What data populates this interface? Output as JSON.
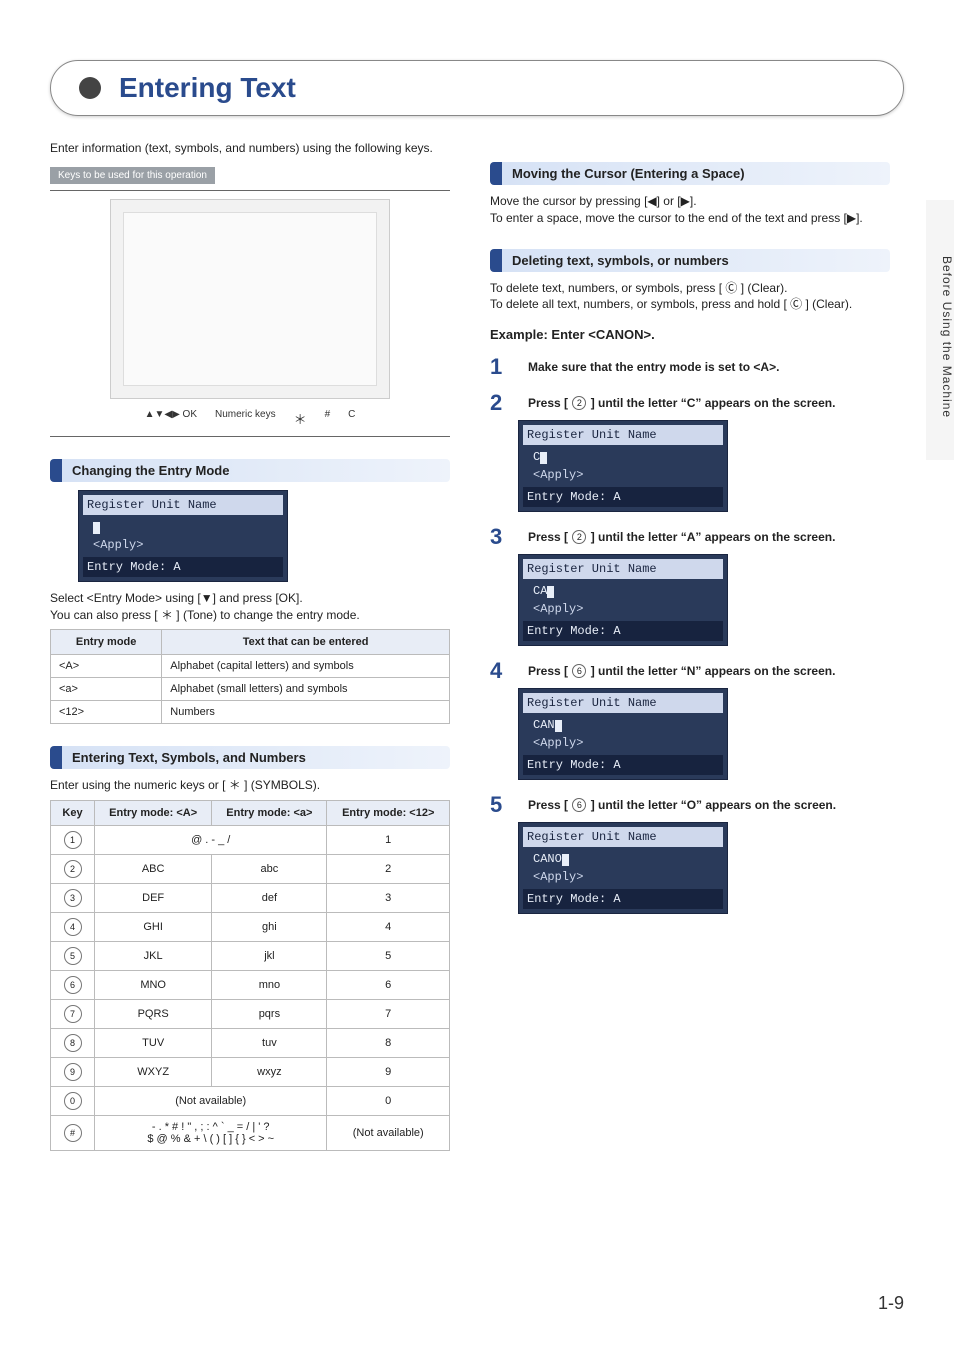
{
  "side_tab": "Before Using the Machine",
  "page_title": "Entering Text",
  "intro": "Enter information (text, symbols, and numbers) using the following keys.",
  "keys_bar": "Keys to be used for this operation",
  "diagram_labels": [
    "▲▼◀▶ OK",
    "Numeric keys",
    "＊",
    "#",
    "C"
  ],
  "changing_mode": {
    "title": "Changing the Entry Mode",
    "lcd": {
      "l1": "Register Unit Name",
      "l2": "",
      "l3": "<Apply>",
      "l4": "Entry Mode: A"
    },
    "note1": "Select <Entry Mode> using [▼]  and press [OK].",
    "note2": "You can also press [ ＊ ] (Tone) to change the entry mode.",
    "table": {
      "h1": "Entry mode",
      "h2": "Text that can be entered",
      "rows": [
        {
          "m": "<A>",
          "t": "Alphabet (capital letters) and symbols"
        },
        {
          "m": "<a>",
          "t": "Alphabet (small letters) and symbols"
        },
        {
          "m": "<12>",
          "t": "Numbers"
        }
      ]
    }
  },
  "entering_tsn": {
    "title": "Entering Text, Symbols, and Numbers",
    "note": "Enter using the numeric keys or [ ＊ ] (SYMBOLS).",
    "headers": {
      "k": "Key",
      "A": "Entry mode: <A>",
      "a": "Entry mode: <a>",
      "n": "Entry mode: <12>"
    },
    "rows": [
      {
        "key": "1",
        "A": "@ . - _ /",
        "a": "(span)",
        "n": "1",
        "span": true
      },
      {
        "key": "2",
        "A": "ABC",
        "a": "abc",
        "n": "2"
      },
      {
        "key": "3",
        "A": "DEF",
        "a": "def",
        "n": "3"
      },
      {
        "key": "4",
        "A": "GHI",
        "a": "ghi",
        "n": "4"
      },
      {
        "key": "5",
        "A": "JKL",
        "a": "jkl",
        "n": "5"
      },
      {
        "key": "6",
        "A": "MNO",
        "a": "mno",
        "n": "6"
      },
      {
        "key": "7",
        "A": "PQRS",
        "a": "pqrs",
        "n": "7"
      },
      {
        "key": "8",
        "A": "TUV",
        "a": "tuv",
        "n": "8"
      },
      {
        "key": "9",
        "A": "WXYZ",
        "a": "wxyz",
        "n": "9"
      },
      {
        "key": "0",
        "A": "(Not available)",
        "a": "(span)",
        "n": "0",
        "span": true
      },
      {
        "key": "#",
        "A": "- . * # ! \" , ; : ^ ` _ = / | ' ?\n$ @ % & + \\ ( ) [ ] { } < > ~",
        "a": "(span)",
        "n": "(Not available)",
        "span": true
      }
    ]
  },
  "moving_cursor": {
    "title": "Moving the Cursor (Entering a Space)",
    "l1": "Move the cursor by pressing [◀] or [▶].",
    "l2": "To enter a space, move the cursor to the end of the text and press [▶]."
  },
  "deleting": {
    "title": "Deleting text, symbols, or numbers",
    "l1": "To delete text, numbers, or symbols, press [ Ⓒ ] (Clear).",
    "l2": "To delete all text, numbers, or symbols, press and hold [ Ⓒ ] (Clear)."
  },
  "example_h": "Example: Enter <CANON>.",
  "steps": [
    {
      "n": "1",
      "t": "Make sure that the entry mode is set to <A>."
    },
    {
      "n": "2",
      "t_pre": "Press [ ",
      "key": "2",
      "t_post": " ] until the letter “C” appears on the screen.",
      "lcd": {
        "l1": "Register Unit Name",
        "l2": "C",
        "l3": "<Apply>",
        "l4": "Entry Mode: A"
      }
    },
    {
      "n": "3",
      "t_pre": "Press [ ",
      "key": "2",
      "t_post": " ] until the letter “A” appears on the screen.",
      "lcd": {
        "l1": "Register Unit Name",
        "l2": "CA",
        "l3": "<Apply>",
        "l4": "Entry Mode: A"
      }
    },
    {
      "n": "4",
      "t_pre": "Press [ ",
      "key": "6",
      "t_post": " ] until the letter “N” appears on the screen.",
      "lcd": {
        "l1": "Register Unit Name",
        "l2": "CAN",
        "l3": "<Apply>",
        "l4": "Entry Mode: A"
      }
    },
    {
      "n": "5",
      "t_pre": "Press [ ",
      "key": "6",
      "t_post": " ] until the letter “O” appears on the screen.",
      "lcd": {
        "l1": "Register Unit Name",
        "l2": "CANO",
        "l3": "<Apply>",
        "l4": "Entry Mode: A"
      }
    }
  ],
  "page_num": "1-9"
}
